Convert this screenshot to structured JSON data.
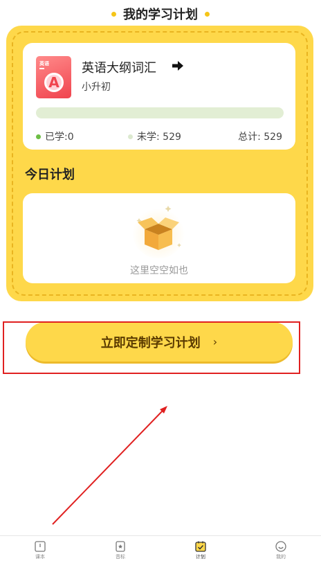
{
  "header": {
    "title": "我的学习计划"
  },
  "book": {
    "cover_text": "英语",
    "cover_letter": "A",
    "title": "英语大纲词汇",
    "level": "小升初",
    "progress": 0,
    "learned_label": "已学:0",
    "unlearned_label": "未学: 529",
    "total_label": "总计: 529"
  },
  "today": {
    "title": "今日计划",
    "empty_text": "这里空空如也"
  },
  "cta": {
    "label": "立即定制学习计划",
    "chevron": "›"
  },
  "tabbar": {
    "items": [
      {
        "label": "课本",
        "icon": "book-icon",
        "active": false
      },
      {
        "label": "音标",
        "icon": "phonetic-icon",
        "active": false
      },
      {
        "label": "计划",
        "icon": "calendar-check-icon",
        "active": true
      },
      {
        "label": "我的",
        "icon": "smile-icon",
        "active": false
      }
    ]
  },
  "colors": {
    "accent": "#FED84A",
    "accent_dark": "#E9B420",
    "progress_track": "#E2EED4",
    "learned_dot": "#6DBE45",
    "annotation_red": "#E02020"
  }
}
